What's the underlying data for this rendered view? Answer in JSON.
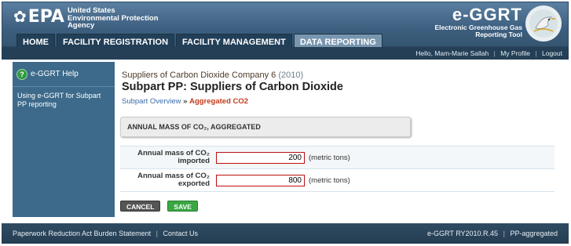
{
  "header": {
    "agency_line1": "United States",
    "agency_line2": "Environmental Protection",
    "agency_line3": "Agency",
    "logo_text": "EPA",
    "app_logo": "e-GGRT",
    "app_sub1": "Electronic Greenhouse Gas",
    "app_sub2": "Reporting Tool"
  },
  "nav": [
    "HOME",
    "FACILITY REGISTRATION",
    "FACILITY MANAGEMENT",
    "DATA REPORTING"
  ],
  "userbar": {
    "greeting": "Hello, Mam-Marie Sallah",
    "profile": "My Profile",
    "logout": "Logout"
  },
  "sidebar": {
    "help": "e-GGRT Help",
    "link": "Using e-GGRT for Subpart PP reporting"
  },
  "content": {
    "company": "Suppliers of Carbon Dioxide Company 6",
    "year": "(2010)",
    "subpart": "Subpart PP: Suppliers of Carbon Dioxide",
    "crumb_link": "Subpart Overview",
    "crumb_sep": "»",
    "crumb_current": "Aggregated CO2",
    "section_title": "ANNUAL MASS OF CO₂, AGGREGATED",
    "rows": [
      {
        "label": "Annual mass of CO₂ imported",
        "value": "200",
        "unit": "(metric tons)"
      },
      {
        "label": "Annual mass of CO₂ exported",
        "value": "800",
        "unit": "(metric tons)"
      }
    ],
    "cancel": "CANCEL",
    "save": "SAVE"
  },
  "footer": {
    "paperwork": "Paperwork Reduction Act Burden Statement",
    "contact": "Contact Us",
    "version": "e-GGRT RY2010.R.45",
    "page": "PP-aggregated"
  }
}
